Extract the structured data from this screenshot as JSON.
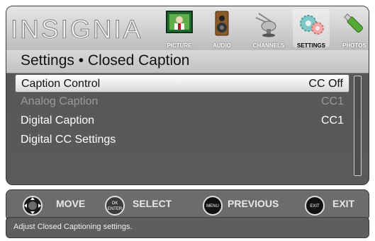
{
  "brand": "INSIGNIA",
  "tabs": [
    {
      "label": "PICTURE",
      "icon": "picture-icon",
      "selected": false
    },
    {
      "label": "AUDIO",
      "icon": "speaker-icon",
      "selected": false
    },
    {
      "label": "CHANNELS",
      "icon": "satellite-dish-icon",
      "selected": false
    },
    {
      "label": "SETTINGS",
      "icon": "gears-icon",
      "selected": true
    },
    {
      "label": "PHOTOS",
      "icon": "usb-drive-icon",
      "selected": false
    }
  ],
  "breadcrumb": "Settings • Closed Caption",
  "menu": {
    "items": [
      {
        "label": "Caption Control",
        "value": "CC Off",
        "state": "selected"
      },
      {
        "label": "Analog Caption",
        "value": "CC1",
        "state": "disabled"
      },
      {
        "label": "Digital Caption",
        "value": "CC1",
        "state": "normal"
      },
      {
        "label": "Digital CC Settings",
        "value": "",
        "state": "normal"
      }
    ]
  },
  "hints": [
    {
      "key": "",
      "label": "MOVE",
      "icon": "dpad-icon"
    },
    {
      "key": "OK ENTER",
      "label": "SELECT",
      "icon": "ok-enter-icon"
    },
    {
      "key": "MENU",
      "label": "PREVIOUS",
      "icon": "menu-button-icon"
    },
    {
      "key": "EXIT",
      "label": "EXIT",
      "icon": "exit-button-icon"
    }
  ],
  "help_text": "Adjust Closed Captioning settings.",
  "colors": {
    "panel_dark": "#5a5a5a",
    "header_light": "#d4d4d4",
    "highlight": "#ffffff",
    "text_disabled": "#9a9a9a"
  }
}
